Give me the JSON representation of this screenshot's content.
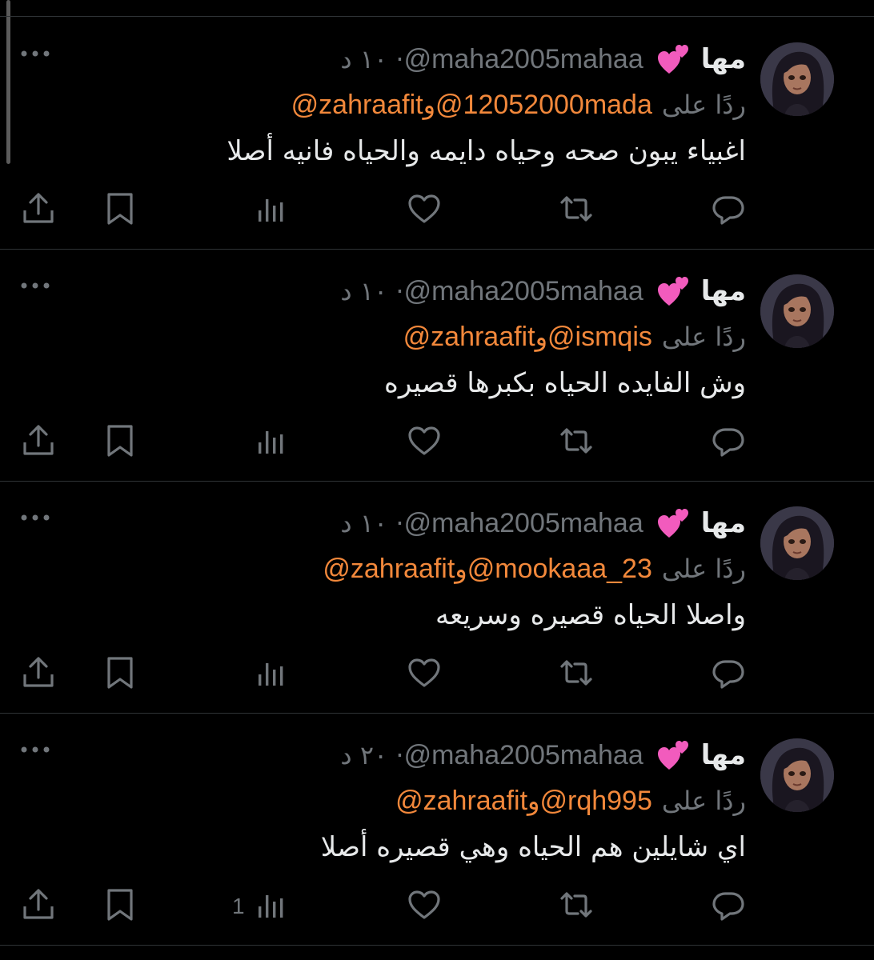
{
  "tweets": [
    {
      "name": "مها",
      "handle": "@maha2005mahaa",
      "time": "· ١٠ د",
      "reply_prefix": "ردًا على",
      "mention1": "@12052000mada",
      "conj": "و",
      "mention2": "@zahraafit",
      "text": "اغبياء يبون صحه وحياه دايمه والحياه فانيه أصلا",
      "views": ""
    },
    {
      "name": "مها",
      "handle": "@maha2005mahaa",
      "time": "· ١٠ د",
      "reply_prefix": "ردًا على",
      "mention1": "@ismqis",
      "conj": "و",
      "mention2": "@zahraafit",
      "text": "وش الفايده الحياه بكبرها قصيره",
      "views": ""
    },
    {
      "name": "مها",
      "handle": "@maha2005mahaa",
      "time": "· ١٠ د",
      "reply_prefix": "ردًا على",
      "mention1": "@mookaaa_23",
      "conj": "و",
      "mention2": "@zahraafit",
      "text": "واصلا الحياه قصيره وسريعه",
      "views": ""
    },
    {
      "name": "مها",
      "handle": "@maha2005mahaa",
      "time": "· ٢٠ د",
      "reply_prefix": "ردًا على",
      "mention1": "@rqh995",
      "conj": "و",
      "mention2": "@zahraafit",
      "text": "اي شايلين هم الحياه وهي قصيره أصلا",
      "views": "1"
    }
  ],
  "icons": {
    "reply": "reply-icon",
    "retweet": "retweet-icon",
    "like": "like-icon",
    "views": "views-icon",
    "bookmark": "bookmark-icon",
    "share": "share-icon",
    "more": "more-icon",
    "emoji": "two-hearts-emoji"
  },
  "colors": {
    "background": "#000000",
    "text": "#e7e9ea",
    "secondary": "#71767b",
    "mention": "#f2883b",
    "divider": "#2f3336"
  }
}
